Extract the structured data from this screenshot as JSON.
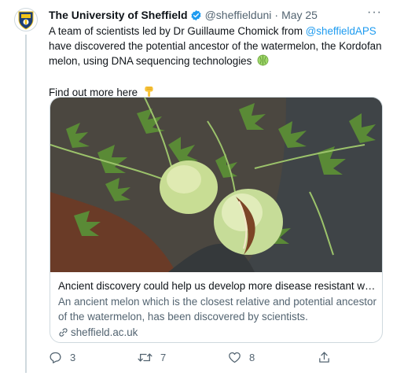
{
  "account": {
    "name": "The University of Sheffield",
    "handle": "@sheffielduni",
    "separator": "·",
    "date": "May 25",
    "more": "···"
  },
  "tweet": {
    "text_before_mention": "A team of scientists led by Dr Guillaume Chomick from ",
    "mention": "@sheffieldAPS",
    "text_after_mention": " have discovered the potential ancestor of the watermelon, the Kordofan melon, using DNA sequencing technologies",
    "text_second_paragraph": "Find out more here"
  },
  "card": {
    "title": "Ancient discovery could help us develop more disease resistant wat...",
    "description": "An ancient melon which is the closest relative and potential ancestor of the watermelon, has been discovered by scientists.",
    "domain": "sheffield.ac.uk"
  },
  "actions": {
    "replies": "3",
    "retweets": "7",
    "likes": "8"
  },
  "colors": {
    "accent": "#1d9bf0",
    "secondary_text": "#536471",
    "university_navy": "#1d3e74"
  }
}
